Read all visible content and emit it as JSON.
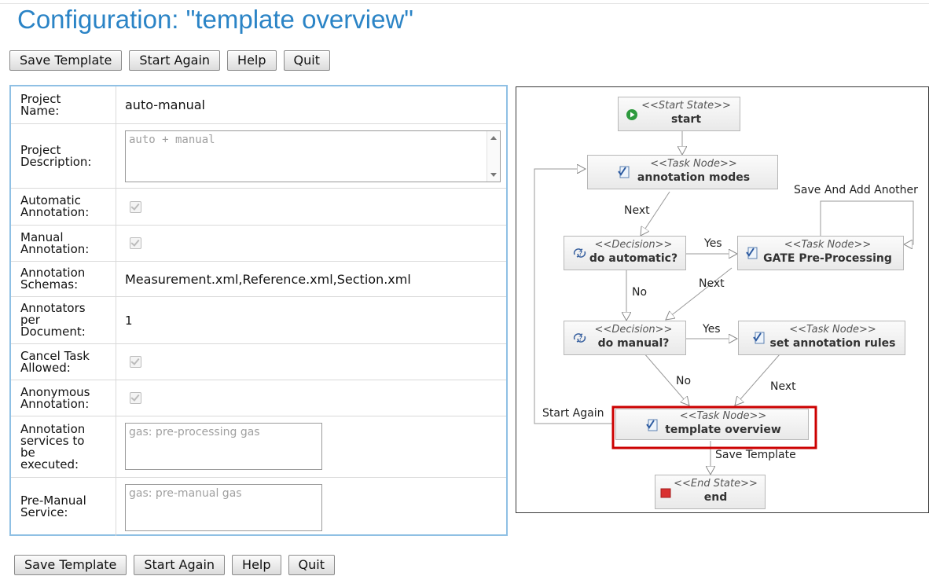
{
  "page": {
    "title": "Configuration: \"template overview\""
  },
  "buttons": {
    "save": "Save Template",
    "start_again": "Start Again",
    "help": "Help",
    "quit": "Quit"
  },
  "form": {
    "project_name": {
      "label": "Project\nName:",
      "value": "auto-manual"
    },
    "project_description": {
      "label": "Project\nDescription:",
      "value": "auto + manual"
    },
    "automatic_annotation": {
      "label": "Automatic\nAnnotation:",
      "checked": true
    },
    "manual_annotation": {
      "label": "Manual\nAnnotation:",
      "checked": true
    },
    "annotation_schemas": {
      "label": "Annotation\nSchemas:",
      "value": "Measurement.xml,Reference.xml,Section.xml"
    },
    "annotators_per_document": {
      "label": "Annotators\nper\nDocument:",
      "value": "1"
    },
    "cancel_task_allowed": {
      "label": "Cancel Task\nAllowed:",
      "checked": true
    },
    "anonymous_annotation": {
      "label": "Anonymous\nAnnotation:",
      "checked": true
    },
    "annotation_services": {
      "label": "Annotation\nservices to\nbe\nexecuted:",
      "value": "gas: pre-processing gas"
    },
    "pre_manual_service": {
      "label": "Pre-Manual\nService:",
      "value": "gas: pre-manual gas"
    }
  },
  "workflow": {
    "nodes": {
      "start": {
        "stereotype": "<<Start State>>",
        "name": "start",
        "icon": "play-icon",
        "color": "#2e9a3e"
      },
      "annotation_modes": {
        "stereotype": "<<Task Node>>",
        "name": "annotation modes",
        "icon": "task-node-icon"
      },
      "gate_preprocessing": {
        "stereotype": "<<Task Node>>",
        "name": "GATE Pre-Processing",
        "icon": "task-node-icon"
      },
      "do_automatic": {
        "stereotype": "<<Decision>>",
        "name": "do automatic?",
        "icon": "decision-icon"
      },
      "do_manual": {
        "stereotype": "<<Decision>>",
        "name": "do manual?",
        "icon": "decision-icon"
      },
      "set_annotation_rules": {
        "stereotype": "<<Task Node>>",
        "name": "set annotation rules",
        "icon": "task-node-icon"
      },
      "template_overview": {
        "stereotype": "<<Task Node>>",
        "name": "template overview",
        "icon": "task-node-icon",
        "highlight_color": "#cc0000"
      },
      "end": {
        "stereotype": "<<End State>>",
        "name": "end",
        "icon": "stop-icon",
        "color": "#d93030"
      }
    },
    "transitions": {
      "modes_next": "Next",
      "save_and_add_another": "Save And Add Another",
      "auto_yes": "Yes",
      "gate_next": "Next",
      "auto_no": "No",
      "manual_yes": "Yes",
      "manual_no": "No",
      "rules_next": "Next",
      "start_again": "Start Again",
      "save_template": "Save Template"
    }
  },
  "colors": {
    "title": "#2b84c6",
    "panel_border": "#8fc0e4",
    "highlight": "#cc0000"
  }
}
